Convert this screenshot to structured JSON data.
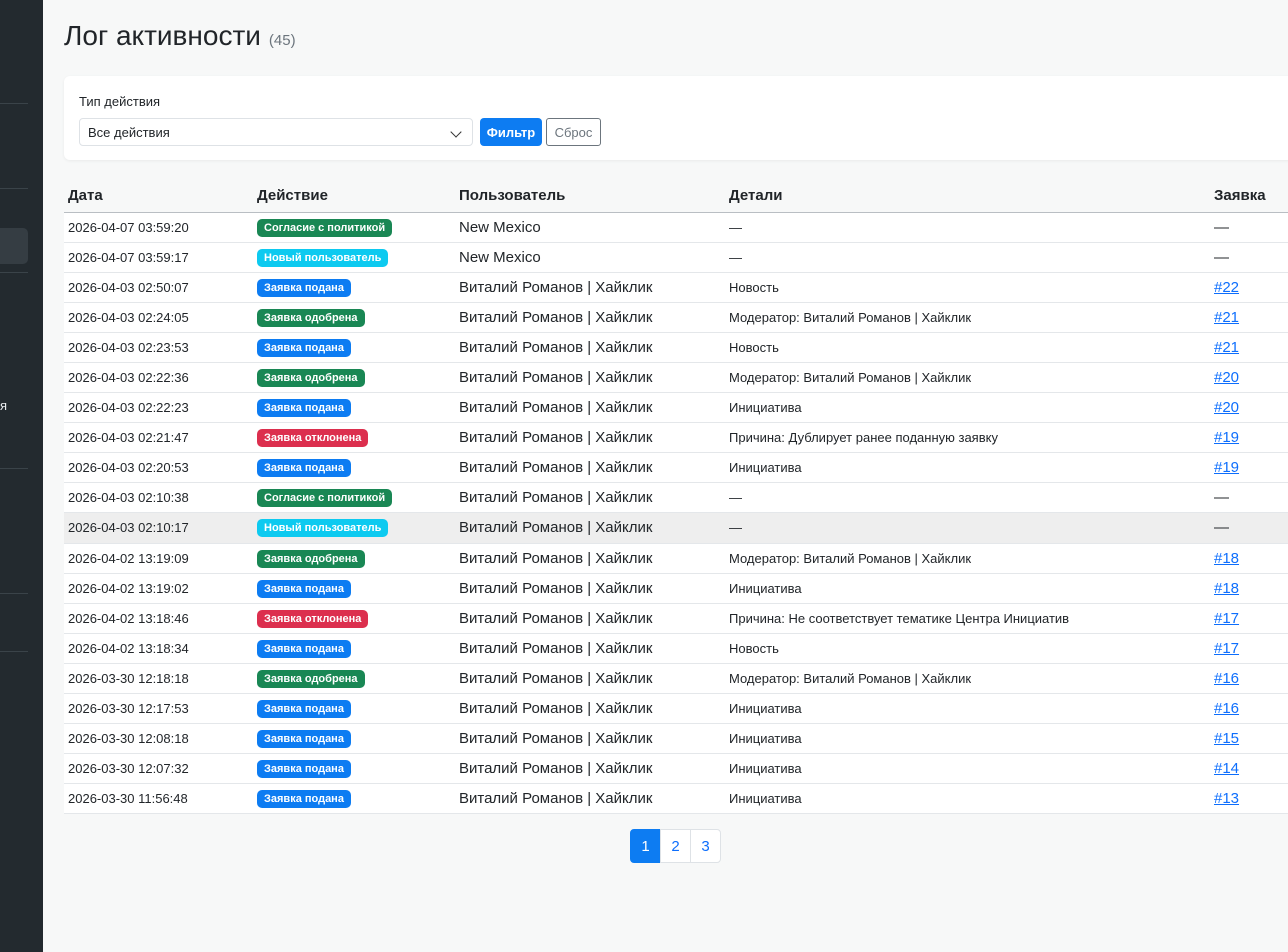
{
  "page": {
    "title": "Лог активности",
    "count": "(45)"
  },
  "sidebar": {
    "partial_text": "я"
  },
  "filter": {
    "label": "Тип действия",
    "select_value": "Все действия",
    "filter_button": "Фильтр",
    "reset_button": "Сброс"
  },
  "table": {
    "headers": {
      "date": "Дата",
      "action": "Действие",
      "user": "Пользователь",
      "details": "Детали",
      "request": "Заявка"
    },
    "rows": [
      {
        "date": "2026-04-07 03:59:20",
        "action": "Согласие с политикой",
        "action_color": "#198754",
        "user": "New Mexico",
        "details": "—",
        "request": "—",
        "request_link": false
      },
      {
        "date": "2026-04-07 03:59:17",
        "action": "Новый пользователь",
        "action_color": "#0dcaf0",
        "user": "New Mexico",
        "details": "—",
        "request": "—",
        "request_link": false
      },
      {
        "date": "2026-04-03 02:50:07",
        "action": "Заявка подана",
        "action_color": "#0d7cf2",
        "user": "Виталий Романов | Хайклик",
        "details": "Новость",
        "request": "#22",
        "request_link": true
      },
      {
        "date": "2026-04-03 02:24:05",
        "action": "Заявка одобрена",
        "action_color": "#198754",
        "user": "Виталий Романов | Хайклик",
        "details": "Модератор: Виталий Романов | Хайклик",
        "request": "#21",
        "request_link": true
      },
      {
        "date": "2026-04-03 02:23:53",
        "action": "Заявка подана",
        "action_color": "#0d7cf2",
        "user": "Виталий Романов | Хайклик",
        "details": "Новость",
        "request": "#21",
        "request_link": true
      },
      {
        "date": "2026-04-03 02:22:36",
        "action": "Заявка одобрена",
        "action_color": "#198754",
        "user": "Виталий Романов | Хайклик",
        "details": "Модератор: Виталий Романов | Хайклик",
        "request": "#20",
        "request_link": true
      },
      {
        "date": "2026-04-03 02:22:23",
        "action": "Заявка подана",
        "action_color": "#0d7cf2",
        "user": "Виталий Романов | Хайклик",
        "details": "Инициатива",
        "request": "#20",
        "request_link": true
      },
      {
        "date": "2026-04-03 02:21:47",
        "action": "Заявка отклонена",
        "action_color": "#dc2f4e",
        "user": "Виталий Романов | Хайклик",
        "details": "Причина: Дублирует ранее поданную заявку",
        "request": "#19",
        "request_link": true
      },
      {
        "date": "2026-04-03 02:20:53",
        "action": "Заявка подана",
        "action_color": "#0d7cf2",
        "user": "Виталий Романов | Хайклик",
        "details": "Инициатива",
        "request": "#19",
        "request_link": true
      },
      {
        "date": "2026-04-03 02:10:38",
        "action": "Согласие с политикой",
        "action_color": "#198754",
        "user": "Виталий Романов | Хайклик",
        "details": "—",
        "request": "—",
        "request_link": false
      },
      {
        "date": "2026-04-03 02:10:17",
        "action": "Новый пользователь",
        "action_color": "#0dcaf0",
        "user": "Виталий Романов | Хайклик",
        "details": "—",
        "request": "—",
        "request_link": false,
        "highlighted": true
      },
      {
        "date": "2026-04-02 13:19:09",
        "action": "Заявка одобрена",
        "action_color": "#198754",
        "user": "Виталий Романов | Хайклик",
        "details": "Модератор: Виталий Романов | Хайклик",
        "request": "#18",
        "request_link": true
      },
      {
        "date": "2026-04-02 13:19:02",
        "action": "Заявка подана",
        "action_color": "#0d7cf2",
        "user": "Виталий Романов | Хайклик",
        "details": "Инициатива",
        "request": "#18",
        "request_link": true
      },
      {
        "date": "2026-04-02 13:18:46",
        "action": "Заявка отклонена",
        "action_color": "#dc2f4e",
        "user": "Виталий Романов | Хайклик",
        "details": "Причина: Не соответствует тематике Центра Инициатив",
        "request": "#17",
        "request_link": true
      },
      {
        "date": "2026-04-02 13:18:34",
        "action": "Заявка подана",
        "action_color": "#0d7cf2",
        "user": "Виталий Романов | Хайклик",
        "details": "Новость",
        "request": "#17",
        "request_link": true
      },
      {
        "date": "2026-03-30 12:18:18",
        "action": "Заявка одобрена",
        "action_color": "#198754",
        "user": "Виталий Романов | Хайклик",
        "details": "Модератор: Виталий Романов | Хайклик",
        "request": "#16",
        "request_link": true
      },
      {
        "date": "2026-03-30 12:17:53",
        "action": "Заявка подана",
        "action_color": "#0d7cf2",
        "user": "Виталий Романов | Хайклик",
        "details": "Инициатива",
        "request": "#16",
        "request_link": true
      },
      {
        "date": "2026-03-30 12:08:18",
        "action": "Заявка подана",
        "action_color": "#0d7cf2",
        "user": "Виталий Романов | Хайклик",
        "details": "Инициатива",
        "request": "#15",
        "request_link": true
      },
      {
        "date": "2026-03-30 12:07:32",
        "action": "Заявка подана",
        "action_color": "#0d7cf2",
        "user": "Виталий Романов | Хайклик",
        "details": "Инициатива",
        "request": "#14",
        "request_link": true
      },
      {
        "date": "2026-03-30 11:56:48",
        "action": "Заявка подана",
        "action_color": "#0d7cf2",
        "user": "Виталий Романов | Хайклик",
        "details": "Инициатива",
        "request": "#13",
        "request_link": true
      }
    ]
  },
  "pagination": {
    "pages": [
      "1",
      "2",
      "3"
    ],
    "current": "1"
  }
}
